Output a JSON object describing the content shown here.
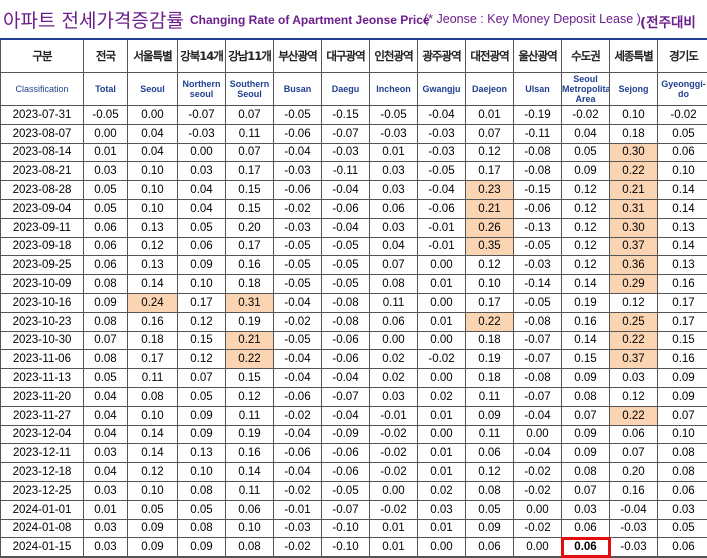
{
  "title": {
    "korean": "아파트 전세가격증감률",
    "english": "Changing Rate of Apartment Jeonse Price",
    "note": "(* Jeonse : Key Money Deposit Lease )",
    "right": "(전주대비"
  },
  "columns": [
    {
      "ko": "구분",
      "en": "Classification"
    },
    {
      "ko": "전국",
      "en": "Total"
    },
    {
      "ko": "서울특별",
      "en": "Seoul"
    },
    {
      "ko": "강북14개",
      "en": "Northern seoul"
    },
    {
      "ko": "강남11개",
      "en": "Southern Seoul"
    },
    {
      "ko": "부산광역",
      "en": "Busan"
    },
    {
      "ko": "대구광역",
      "en": "Daegu"
    },
    {
      "ko": "인천광역",
      "en": "Incheon"
    },
    {
      "ko": "광주광역",
      "en": "Gwangju"
    },
    {
      "ko": "대전광역",
      "en": "Daejeon"
    },
    {
      "ko": "울산광역",
      "en": "Ulsan"
    },
    {
      "ko": "수도권",
      "en": "Seoul Metropolitan Area"
    },
    {
      "ko": "세종특별",
      "en": "Sejong"
    },
    {
      "ko": "경기도",
      "en": "Gyeonggi-do"
    }
  ],
  "rows": [
    {
      "date": "2023-07-31",
      "v": [
        "-0.05",
        "0.00",
        "-0.07",
        "0.07",
        "-0.05",
        "-0.15",
        "-0.05",
        "-0.04",
        "0.01",
        "-0.19",
        "-0.02",
        "0.10",
        "-0.02"
      ]
    },
    {
      "date": "2023-08-07",
      "v": [
        "0.00",
        "0.04",
        "-0.03",
        "0.11",
        "-0.06",
        "-0.07",
        "-0.03",
        "-0.03",
        "0.07",
        "-0.11",
        "0.04",
        "0.18",
        "0.05"
      ]
    },
    {
      "date": "2023-08-14",
      "v": [
        "0.01",
        "0.04",
        "0.00",
        "0.07",
        "-0.04",
        "-0.03",
        "0.01",
        "-0.03",
        "0.12",
        "-0.08",
        "0.05",
        "0.30",
        "0.06"
      ]
    },
    {
      "date": "2023-08-21",
      "v": [
        "0.03",
        "0.10",
        "0.03",
        "0.17",
        "-0.03",
        "-0.11",
        "0.03",
        "-0.05",
        "0.17",
        "-0.08",
        "0.09",
        "0.22",
        "0.10"
      ]
    },
    {
      "date": "2023-08-28",
      "v": [
        "0.05",
        "0.10",
        "0.04",
        "0.15",
        "-0.06",
        "-0.04",
        "0.03",
        "-0.04",
        "0.23",
        "-0.15",
        "0.12",
        "0.21",
        "0.14"
      ]
    },
    {
      "date": "2023-09-04",
      "v": [
        "0.05",
        "0.10",
        "0.04",
        "0.15",
        "-0.02",
        "-0.06",
        "0.06",
        "-0.06",
        "0.21",
        "-0.06",
        "0.12",
        "0.31",
        "0.14"
      ]
    },
    {
      "date": "2023-09-11",
      "v": [
        "0.06",
        "0.13",
        "0.05",
        "0.20",
        "-0.03",
        "-0.04",
        "0.03",
        "-0.01",
        "0.26",
        "-0.13",
        "0.12",
        "0.30",
        "0.13"
      ]
    },
    {
      "date": "2023-09-18",
      "v": [
        "0.06",
        "0.12",
        "0.06",
        "0.17",
        "-0.05",
        "-0.05",
        "0.04",
        "-0.01",
        "0.35",
        "-0.05",
        "0.12",
        "0.37",
        "0.14"
      ]
    },
    {
      "date": "2023-09-25",
      "v": [
        "0.06",
        "0.13",
        "0.09",
        "0.16",
        "-0.05",
        "-0.05",
        "0.07",
        "0.00",
        "0.12",
        "-0.03",
        "0.12",
        "0.36",
        "0.13"
      ]
    },
    {
      "date": "2023-10-09",
      "v": [
        "0.08",
        "0.14",
        "0.10",
        "0.18",
        "-0.05",
        "-0.05",
        "0.08",
        "0.01",
        "0.10",
        "-0.14",
        "0.14",
        "0.29",
        "0.16"
      ]
    },
    {
      "date": "2023-10-16",
      "v": [
        "0.09",
        "0.24",
        "0.17",
        "0.31",
        "-0.04",
        "-0.08",
        "0.11",
        "0.00",
        "0.17",
        "-0.05",
        "0.19",
        "0.12",
        "0.17"
      ]
    },
    {
      "date": "2023-10-23",
      "v": [
        "0.08",
        "0.16",
        "0.12",
        "0.19",
        "-0.02",
        "-0.08",
        "0.06",
        "0.01",
        "0.22",
        "-0.08",
        "0.16",
        "0.25",
        "0.17"
      ]
    },
    {
      "date": "2023-10-30",
      "v": [
        "0.07",
        "0.18",
        "0.15",
        "0.21",
        "-0.05",
        "-0.06",
        "0.00",
        "0.00",
        "0.18",
        "-0.07",
        "0.14",
        "0.22",
        "0.15"
      ]
    },
    {
      "date": "2023-11-06",
      "v": [
        "0.08",
        "0.17",
        "0.12",
        "0.22",
        "-0.04",
        "-0.06",
        "0.02",
        "-0.02",
        "0.19",
        "-0.07",
        "0.15",
        "0.37",
        "0.16"
      ]
    },
    {
      "date": "2023-11-13",
      "v": [
        "0.05",
        "0.11",
        "0.07",
        "0.15",
        "-0.04",
        "-0.04",
        "0.02",
        "0.00",
        "0.18",
        "-0.08",
        "0.09",
        "0.03",
        "0.09"
      ]
    },
    {
      "date": "2023-11-20",
      "v": [
        "0.04",
        "0.08",
        "0.05",
        "0.12",
        "-0.06",
        "-0.07",
        "0.03",
        "0.02",
        "0.11",
        "-0.07",
        "0.08",
        "0.12",
        "0.09"
      ]
    },
    {
      "date": "2023-11-27",
      "v": [
        "0.04",
        "0.10",
        "0.09",
        "0.11",
        "-0.02",
        "-0.04",
        "-0.01",
        "0.01",
        "0.09",
        "-0.04",
        "0.07",
        "0.22",
        "0.07"
      ]
    },
    {
      "date": "2023-12-04",
      "v": [
        "0.04",
        "0.14",
        "0.09",
        "0.19",
        "-0.04",
        "-0.09",
        "-0.02",
        "0.00",
        "0.11",
        "0.00",
        "0.09",
        "0.06",
        "0.10"
      ]
    },
    {
      "date": "2023-12-11",
      "v": [
        "0.03",
        "0.14",
        "0.13",
        "0.16",
        "-0.06",
        "-0.06",
        "-0.02",
        "0.01",
        "0.06",
        "-0.04",
        "0.09",
        "0.07",
        "0.08"
      ]
    },
    {
      "date": "2023-12-18",
      "v": [
        "0.04",
        "0.12",
        "0.10",
        "0.14",
        "-0.04",
        "-0.06",
        "-0.02",
        "0.01",
        "0.12",
        "-0.02",
        "0.08",
        "0.20",
        "0.08"
      ]
    },
    {
      "date": "2023-12-25",
      "v": [
        "0.03",
        "0.10",
        "0.08",
        "0.11",
        "-0.02",
        "-0.05",
        "0.00",
        "0.02",
        "0.08",
        "-0.02",
        "0.07",
        "0.16",
        "0.06"
      ]
    },
    {
      "date": "2024-01-01",
      "v": [
        "0.01",
        "0.05",
        "0.05",
        "0.06",
        "-0.01",
        "-0.07",
        "-0.02",
        "0.03",
        "0.05",
        "0.00",
        "0.03",
        "-0.04",
        "0.03"
      ]
    },
    {
      "date": "2024-01-08",
      "v": [
        "0.03",
        "0.09",
        "0.08",
        "0.10",
        "-0.03",
        "-0.10",
        "0.01",
        "0.01",
        "0.09",
        "-0.02",
        "0.06",
        "-0.03",
        "0.05"
      ]
    },
    {
      "date": "2024-01-15",
      "v": [
        "0.03",
        "0.09",
        "0.09",
        "0.08",
        "-0.02",
        "-0.10",
        "0.01",
        "0.00",
        "0.06",
        "0.00",
        "0.06",
        "-0.03",
        "0.06"
      ]
    }
  ],
  "highlights": [
    [
      2,
      11
    ],
    [
      3,
      11
    ],
    [
      4,
      8
    ],
    [
      4,
      11
    ],
    [
      5,
      8
    ],
    [
      5,
      11
    ],
    [
      6,
      8
    ],
    [
      6,
      11
    ],
    [
      7,
      8
    ],
    [
      7,
      11
    ],
    [
      8,
      11
    ],
    [
      9,
      11
    ],
    [
      10,
      1
    ],
    [
      10,
      3
    ],
    [
      11,
      8
    ],
    [
      11,
      11
    ],
    [
      12,
      3
    ],
    [
      12,
      11
    ],
    [
      13,
      3
    ],
    [
      13,
      11
    ],
    [
      16,
      11
    ]
  ],
  "boxed": [
    [
      23,
      10
    ]
  ],
  "colors": {
    "title": "#6b1e8c",
    "english_header": "#1f3f8f",
    "highlight": "#fbd4b4",
    "box": "#e01010"
  }
}
